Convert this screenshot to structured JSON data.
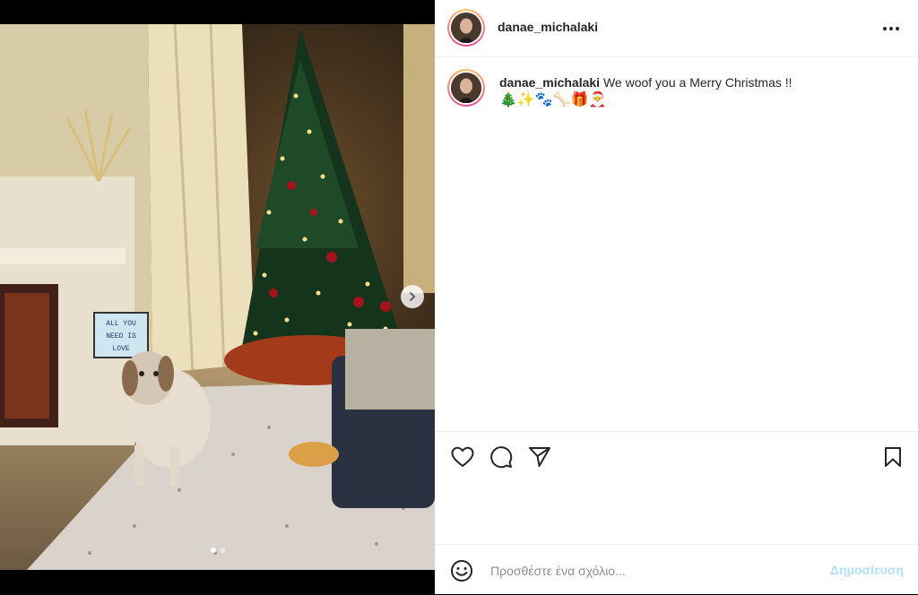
{
  "post": {
    "username": "danae_michalaki",
    "caption_text": "We woof you a Merry Christmas !!",
    "caption_emojis": "🎄✨🐾🦴🎁🎅"
  },
  "media": {
    "carousel_total": 2,
    "carousel_current": 1,
    "lightbox_lines": [
      "ALL YOU",
      "NEED IS",
      "LOVE"
    ]
  },
  "comment": {
    "placeholder": "Προσθέστε ένα σχόλιο...",
    "post_label": "Δημοσίευση"
  },
  "colors": {
    "link_disabled": "#b2dffc",
    "text": "#262626",
    "divider": "#efefef"
  }
}
